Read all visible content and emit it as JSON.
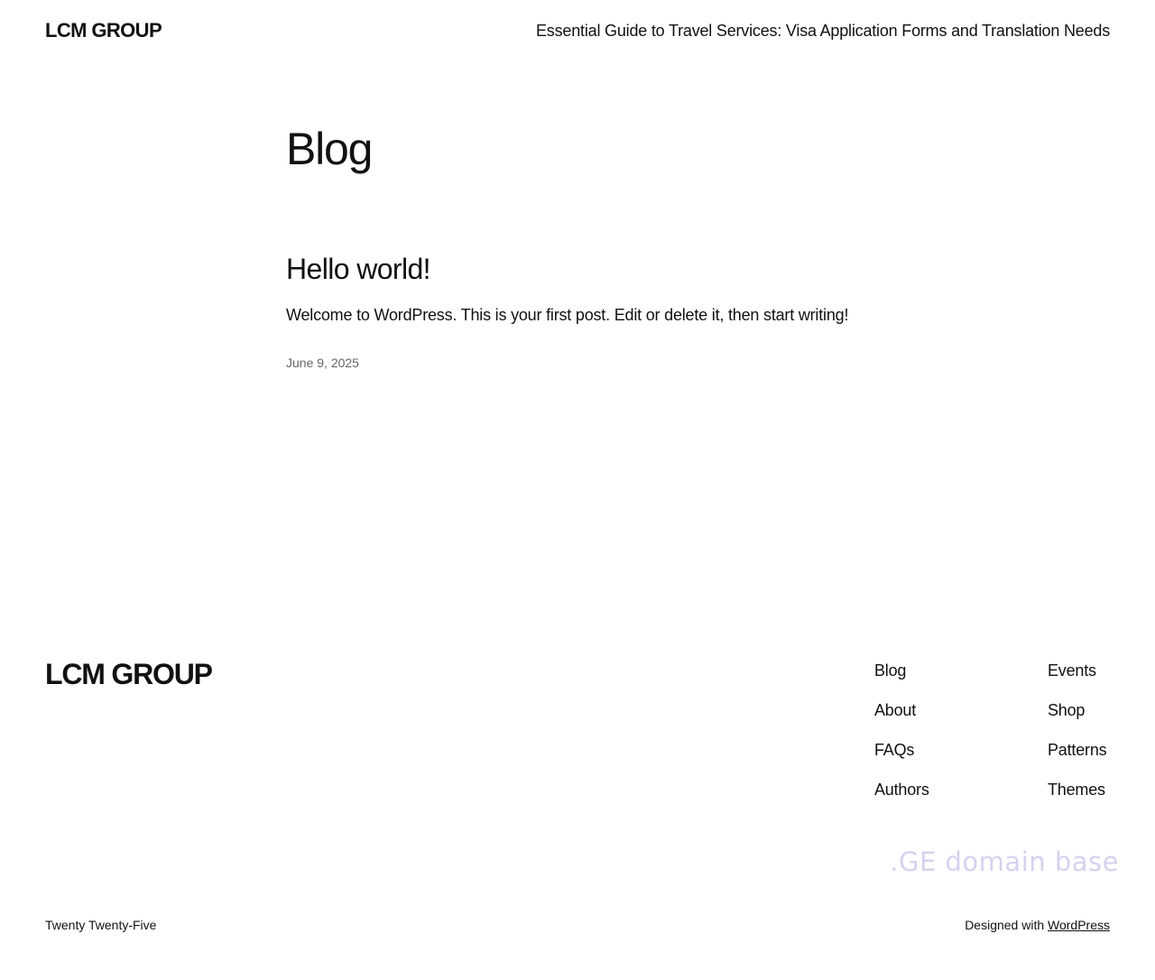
{
  "header": {
    "site_title": "LCM GROUP",
    "nav_link": "Essential Guide to Travel Services: Visa Application Forms and Translation Needs"
  },
  "main": {
    "page_title": "Blog",
    "posts": [
      {
        "title": "Hello world!",
        "excerpt": "Welcome to WordPress. This is your first post. Edit or delete it, then start writing!",
        "date": "June 9, 2025"
      }
    ]
  },
  "footer": {
    "site_title": "LCM GROUP",
    "nav_col1": [
      "Blog",
      "About",
      "FAQs",
      "Authors"
    ],
    "nav_col2": [
      "Events",
      "Shop",
      "Patterns",
      "Themes"
    ],
    "watermark": ".GE domain base",
    "theme_credit": "Twenty Twenty-Five",
    "designed_with": "Designed with",
    "wordpress_link": "WordPress"
  },
  "colors": {
    "text": "#111111",
    "muted": "#666666",
    "watermark": "#d9d0ef",
    "background": "#ffffff"
  }
}
